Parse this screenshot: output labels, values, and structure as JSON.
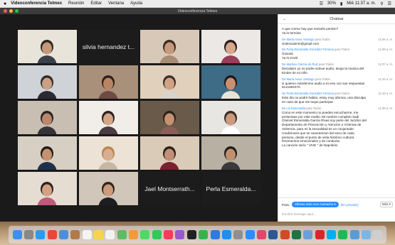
{
  "menubar": {
    "apple": "",
    "app_name": "Videoconferencia Telmex",
    "items": [
      "Reunión",
      "Editar",
      "Ventana",
      "Ayuda"
    ],
    "status": {
      "battery": "30%",
      "datetime": "Mié 11:37 a. m."
    }
  },
  "window": {
    "title": "Videoconferencia Telmex",
    "traffic_lights": [
      "#ff5f57",
      "#febc2e",
      "#28c840"
    ]
  },
  "gallery": {
    "tiles": [
      {
        "kind": "video",
        "bg": "#e9e4da",
        "skin": "#c7977a",
        "hair": "#2a2420",
        "shirt": "#3b3f4a",
        "active": true
      },
      {
        "kind": "name",
        "name": "silvia hernandez t..."
      },
      {
        "kind": "video",
        "bg": "#d8c8b8",
        "skin": "#c89a7c",
        "hair": "#3a2a20",
        "shirt": "#a98c74"
      },
      {
        "kind": "video",
        "bg": "#ece8e6",
        "skin": "#d5a88c",
        "hair": "#2b1d18",
        "shirt": "#9a3d5a"
      },
      {
        "kind": "video",
        "bg": "#cfd2d6",
        "skin": "#caa084",
        "hair": "#332b28",
        "shirt": "#2a2a30"
      },
      {
        "kind": "video",
        "bg": "#a8907a",
        "skin": "#b98466",
        "hair": "#2c2018",
        "shirt": "#6e4c43"
      },
      {
        "kind": "video",
        "bg": "#e0d0bc",
        "skin": "#d1a285",
        "hair": "#40302a",
        "shirt": "#d9d3cb"
      },
      {
        "kind": "video",
        "bg": "#3e6b86",
        "skin": "#c89070",
        "hair": "#1f1a18",
        "shirt": "#e8e2d8"
      },
      {
        "kind": "video",
        "bg": "#c8beb2",
        "skin": "#b8876c",
        "hair": "#2a2220",
        "shirt": "#343438"
      },
      {
        "kind": "video",
        "bg": "#f1ede8",
        "skin": "#d4a688",
        "hair": "#2b221e",
        "shirt": "#4a3c42"
      },
      {
        "kind": "video",
        "bg": "#6a5a4a",
        "skin": "#c59173",
        "hair": "#2d211b",
        "shirt": "#8b5e5a"
      },
      {
        "kind": "video",
        "bg": "#e8e6e2",
        "skin": "#c99a7e",
        "hair": "#3a2c26",
        "shirt": "#ffffff"
      },
      {
        "kind": "video",
        "bg": "#d7cfc4",
        "skin": "#c4926f",
        "hair": "#221a16",
        "shirt": "#20304a"
      },
      {
        "kind": "video",
        "bg": "#ece2d6",
        "skin": "#d8ad90",
        "hair": "#b88850",
        "shirt": "#c6b7a5"
      },
      {
        "kind": "video",
        "bg": "#d9cbb8",
        "skin": "#c29076",
        "hair": "#2a201a",
        "shirt": "#7a2030"
      },
      {
        "kind": "video",
        "bg": "#b8b0a2",
        "skin": "#c1906f",
        "hair": "#231c18",
        "shirt": "#3a3a3a"
      },
      {
        "kind": "video",
        "bg": "#e6ddd2",
        "skin": "#d1a183",
        "hair": "#2c2220",
        "shirt": "#c05a78"
      },
      {
        "kind": "video",
        "bg": "#d0c6ba",
        "skin": "#cb9b7b",
        "hair": "#2f2520",
        "shirt": "#1e1e22"
      },
      {
        "kind": "name",
        "name": "Jael Montserrath..."
      },
      {
        "kind": "name",
        "name": "Perla Esmeralda..."
      }
    ]
  },
  "chat": {
    "title": "Chatear",
    "collapse_icon": "chevron-down-icon",
    "messages": [
      {
        "from": "",
        "to": "",
        "time": "",
        "lines": [
          "A que correo hay que enviarlo perdon?",
          "Ya lo termine"
        ]
      },
      {
        "from": "De María Amac Verdugo",
        "to": "para Todos:",
        "time": "11:06 a. m.",
        "lines": [
          "violenciaimm@gmail.com"
        ]
      },
      {
        "from": "De Perla Esmeralda González Fomena",
        "to": "para Todos:",
        "time": "11:06 a. m.",
        "lines": [
          "Gracias",
          "Ya lo envié"
        ]
      },
      {
        "from": "De Marlene García de Ruiz",
        "to": "para Todos:",
        "time": "11:07 a. m.",
        "lines": [
          "Disculpen yo no podre activar audio, tengo la musica del",
          "Kinder de mi niño"
        ]
      },
      {
        "from": "De María Amac Verdugo",
        "to": "para Todos:",
        "time": "11:10 a. m.",
        "lines": [
          "si quieren mándenme audio a mi eso con sus respuestas",
          "6121691070"
        ]
      },
      {
        "from": "De Perla Esmeralda González Fomena",
        "to": "para Todos:",
        "time": "11:18 a. m.",
        "lines": [
          "Este día no podré hablar, estoy muy afonica, una disculpa",
          "en caso de que me toque participar"
        ]
      },
      {
        "from": "De Liz Esmeralda",
        "to": "para Todos:",
        "time": "11:36 a. m.",
        "lines": [
          "Como en este momento no pueden escucharme, me",
          "presentare por este medio. Mi nombre completo Sadi",
          "Clarivet Esmeralda García Rivas soy parte del Jurídico del",
          "Departamento de Prevención y Atención a Víctimas de",
          "Violencia, para mi la sexualidad es un conjuntode",
          "condiciones que se caracterizan del sexo de cada",
          "persona, desde el punto de vista histórico cultural,",
          "fenomentos emocionales y de conducta.",
          "La canción sería \" VIVE \" de Napoleón"
        ]
      }
    ],
    "composer": {
      "to_label": "Para:",
      "recipient": "Alfonso Iván Arce Camacho",
      "private": "(En privado)",
      "more": "Más",
      "placeholder": "Escribir mensaje aquí..."
    }
  },
  "dock": {
    "icons": [
      {
        "name": "finder-icon",
        "color": "#3d8ef7"
      },
      {
        "name": "launchpad-icon",
        "color": "#888888"
      },
      {
        "name": "safari-icon",
        "color": "#2b9af3"
      },
      {
        "name": "chrome-icon",
        "color": "#e9463a"
      },
      {
        "name": "mail-icon",
        "color": "#4c8ed9"
      },
      {
        "name": "contacts-icon",
        "color": "#b07a4a"
      },
      {
        "name": "calendar-icon",
        "color": "#f4f4f4"
      },
      {
        "name": "notes-icon",
        "color": "#f6d44a"
      },
      {
        "name": "reminders-icon",
        "color": "#f2f2f2"
      },
      {
        "name": "maps-icon",
        "color": "#5dbb63"
      },
      {
        "name": "photos-icon",
        "color": "#f29b38"
      },
      {
        "name": "messages-icon",
        "color": "#4cd964"
      },
      {
        "name": "facetime-icon",
        "color": "#34c759"
      },
      {
        "name": "music-icon",
        "color": "#fa3c5b"
      },
      {
        "name": "podcasts-icon",
        "color": "#9b59d0"
      },
      {
        "name": "tv-icon",
        "color": "#222222"
      },
      {
        "name": "numbers-icon",
        "color": "#35b34a"
      },
      {
        "name": "keynote-icon",
        "color": "#2a7ee0"
      },
      {
        "name": "appstore-icon",
        "color": "#1e8ef1"
      },
      {
        "name": "settings-icon",
        "color": "#8e8e93"
      },
      {
        "name": "zoom-icon",
        "color": "#2d8cff"
      },
      {
        "name": "itunes-icon",
        "color": "#e2466b"
      },
      {
        "name": "word-icon",
        "color": "#2b5797"
      },
      {
        "name": "powerpoint-icon",
        "color": "#d04a25"
      },
      {
        "name": "excel-icon",
        "color": "#1f7244"
      },
      {
        "name": "preview-icon",
        "color": "#6c9fd8"
      },
      {
        "name": "acrobat-icon",
        "color": "#d9262c"
      },
      {
        "name": "skype-icon",
        "color": "#00aff0"
      },
      {
        "name": "spotify-icon",
        "color": "#1db954"
      },
      {
        "name": "downloads-icon",
        "color": "#5a9bd5"
      },
      {
        "name": "folder-icon",
        "color": "#7bb6e8"
      },
      {
        "name": "trash-icon",
        "color": "#cfcfcf"
      }
    ]
  }
}
